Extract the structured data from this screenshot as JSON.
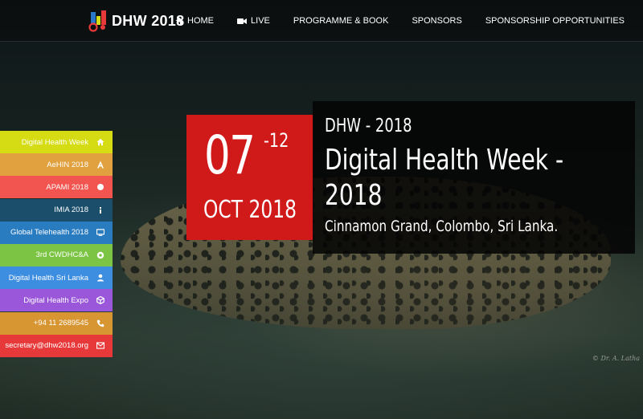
{
  "brand": {
    "name": "DHW 2018"
  },
  "nav": [
    {
      "label": "HOME",
      "icon": "home-icon"
    },
    {
      "label": "LIVE",
      "icon": "video-camera-icon"
    },
    {
      "label": "PROGRAMME & BOOK",
      "icon": ""
    },
    {
      "label": "SPONSORS",
      "icon": ""
    },
    {
      "label": "SPONSORSHIP OPPORTUNITIES",
      "icon": ""
    }
  ],
  "sidebar": {
    "items": [
      {
        "label": "Digital Health Week",
        "icon": "home-icon",
        "color": "#d6dc13"
      },
      {
        "label": "AeHIN 2018",
        "icon": "letter-a-icon",
        "color": "#e0a13e"
      },
      {
        "label": "APAMI 2018",
        "icon": "circle-icon",
        "color": "#f2544f"
      },
      {
        "label": "IMIA 2018",
        "icon": "info-icon",
        "color": "#1b4e6b"
      },
      {
        "label": "Global Telehealth 2018",
        "icon": "monitor-icon",
        "color": "#2a7cc1"
      },
      {
        "label": "3rd CWDHC&A",
        "icon": "chrome-icon",
        "color": "#7cc443"
      },
      {
        "label": "Digital Health Sri Lanka",
        "icon": "user-icon",
        "color": "#3d8ee0"
      },
      {
        "label": "Digital Health Expo",
        "icon": "cube-icon",
        "color": "#9a57d9"
      },
      {
        "label": "+94 11 2689545",
        "icon": "phone-icon",
        "color": "#d89632"
      },
      {
        "label": "secretary@dhw2018.org",
        "icon": "envelope-icon",
        "color": "#e8393a"
      }
    ]
  },
  "event": {
    "date_start": "07",
    "date_end": "-12",
    "month_year": "OCT 2018",
    "subtitle": "DHW - 2018",
    "title": "Digital Health Week - 2018",
    "venue": "Cinnamon Grand, Colombo, Sri Lanka."
  },
  "photo_credit": "© Dr. A. Latha",
  "colors": {
    "date_red": "#d01919",
    "panel_bg": "#050505"
  }
}
